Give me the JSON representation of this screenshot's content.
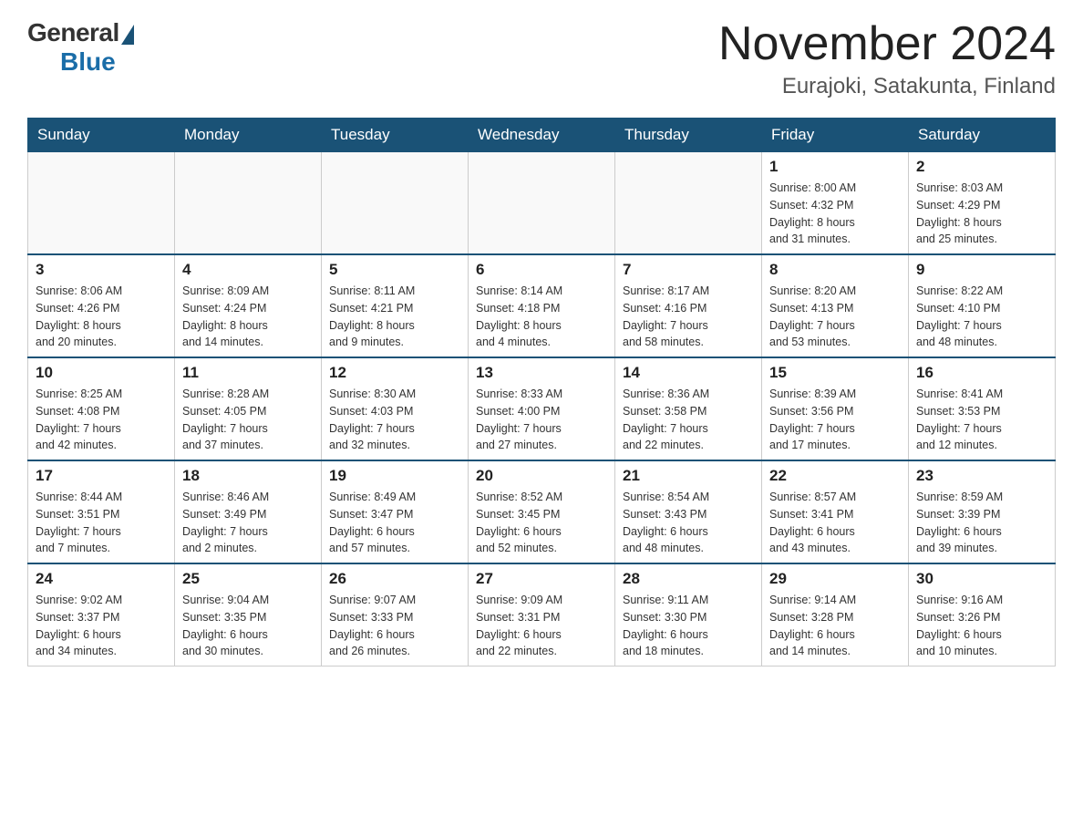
{
  "header": {
    "logo_general": "General",
    "logo_blue": "Blue",
    "month_title": "November 2024",
    "location": "Eurajoki, Satakunta, Finland"
  },
  "days_of_week": [
    "Sunday",
    "Monday",
    "Tuesday",
    "Wednesday",
    "Thursday",
    "Friday",
    "Saturday"
  ],
  "weeks": [
    {
      "days": [
        {
          "num": "",
          "info": ""
        },
        {
          "num": "",
          "info": ""
        },
        {
          "num": "",
          "info": ""
        },
        {
          "num": "",
          "info": ""
        },
        {
          "num": "",
          "info": ""
        },
        {
          "num": "1",
          "info": "Sunrise: 8:00 AM\nSunset: 4:32 PM\nDaylight: 8 hours\nand 31 minutes."
        },
        {
          "num": "2",
          "info": "Sunrise: 8:03 AM\nSunset: 4:29 PM\nDaylight: 8 hours\nand 25 minutes."
        }
      ]
    },
    {
      "days": [
        {
          "num": "3",
          "info": "Sunrise: 8:06 AM\nSunset: 4:26 PM\nDaylight: 8 hours\nand 20 minutes."
        },
        {
          "num": "4",
          "info": "Sunrise: 8:09 AM\nSunset: 4:24 PM\nDaylight: 8 hours\nand 14 minutes."
        },
        {
          "num": "5",
          "info": "Sunrise: 8:11 AM\nSunset: 4:21 PM\nDaylight: 8 hours\nand 9 minutes."
        },
        {
          "num": "6",
          "info": "Sunrise: 8:14 AM\nSunset: 4:18 PM\nDaylight: 8 hours\nand 4 minutes."
        },
        {
          "num": "7",
          "info": "Sunrise: 8:17 AM\nSunset: 4:16 PM\nDaylight: 7 hours\nand 58 minutes."
        },
        {
          "num": "8",
          "info": "Sunrise: 8:20 AM\nSunset: 4:13 PM\nDaylight: 7 hours\nand 53 minutes."
        },
        {
          "num": "9",
          "info": "Sunrise: 8:22 AM\nSunset: 4:10 PM\nDaylight: 7 hours\nand 48 minutes."
        }
      ]
    },
    {
      "days": [
        {
          "num": "10",
          "info": "Sunrise: 8:25 AM\nSunset: 4:08 PM\nDaylight: 7 hours\nand 42 minutes."
        },
        {
          "num": "11",
          "info": "Sunrise: 8:28 AM\nSunset: 4:05 PM\nDaylight: 7 hours\nand 37 minutes."
        },
        {
          "num": "12",
          "info": "Sunrise: 8:30 AM\nSunset: 4:03 PM\nDaylight: 7 hours\nand 32 minutes."
        },
        {
          "num": "13",
          "info": "Sunrise: 8:33 AM\nSunset: 4:00 PM\nDaylight: 7 hours\nand 27 minutes."
        },
        {
          "num": "14",
          "info": "Sunrise: 8:36 AM\nSunset: 3:58 PM\nDaylight: 7 hours\nand 22 minutes."
        },
        {
          "num": "15",
          "info": "Sunrise: 8:39 AM\nSunset: 3:56 PM\nDaylight: 7 hours\nand 17 minutes."
        },
        {
          "num": "16",
          "info": "Sunrise: 8:41 AM\nSunset: 3:53 PM\nDaylight: 7 hours\nand 12 minutes."
        }
      ]
    },
    {
      "days": [
        {
          "num": "17",
          "info": "Sunrise: 8:44 AM\nSunset: 3:51 PM\nDaylight: 7 hours\nand 7 minutes."
        },
        {
          "num": "18",
          "info": "Sunrise: 8:46 AM\nSunset: 3:49 PM\nDaylight: 7 hours\nand 2 minutes."
        },
        {
          "num": "19",
          "info": "Sunrise: 8:49 AM\nSunset: 3:47 PM\nDaylight: 6 hours\nand 57 minutes."
        },
        {
          "num": "20",
          "info": "Sunrise: 8:52 AM\nSunset: 3:45 PM\nDaylight: 6 hours\nand 52 minutes."
        },
        {
          "num": "21",
          "info": "Sunrise: 8:54 AM\nSunset: 3:43 PM\nDaylight: 6 hours\nand 48 minutes."
        },
        {
          "num": "22",
          "info": "Sunrise: 8:57 AM\nSunset: 3:41 PM\nDaylight: 6 hours\nand 43 minutes."
        },
        {
          "num": "23",
          "info": "Sunrise: 8:59 AM\nSunset: 3:39 PM\nDaylight: 6 hours\nand 39 minutes."
        }
      ]
    },
    {
      "days": [
        {
          "num": "24",
          "info": "Sunrise: 9:02 AM\nSunset: 3:37 PM\nDaylight: 6 hours\nand 34 minutes."
        },
        {
          "num": "25",
          "info": "Sunrise: 9:04 AM\nSunset: 3:35 PM\nDaylight: 6 hours\nand 30 minutes."
        },
        {
          "num": "26",
          "info": "Sunrise: 9:07 AM\nSunset: 3:33 PM\nDaylight: 6 hours\nand 26 minutes."
        },
        {
          "num": "27",
          "info": "Sunrise: 9:09 AM\nSunset: 3:31 PM\nDaylight: 6 hours\nand 22 minutes."
        },
        {
          "num": "28",
          "info": "Sunrise: 9:11 AM\nSunset: 3:30 PM\nDaylight: 6 hours\nand 18 minutes."
        },
        {
          "num": "29",
          "info": "Sunrise: 9:14 AM\nSunset: 3:28 PM\nDaylight: 6 hours\nand 14 minutes."
        },
        {
          "num": "30",
          "info": "Sunrise: 9:16 AM\nSunset: 3:26 PM\nDaylight: 6 hours\nand 10 minutes."
        }
      ]
    }
  ]
}
